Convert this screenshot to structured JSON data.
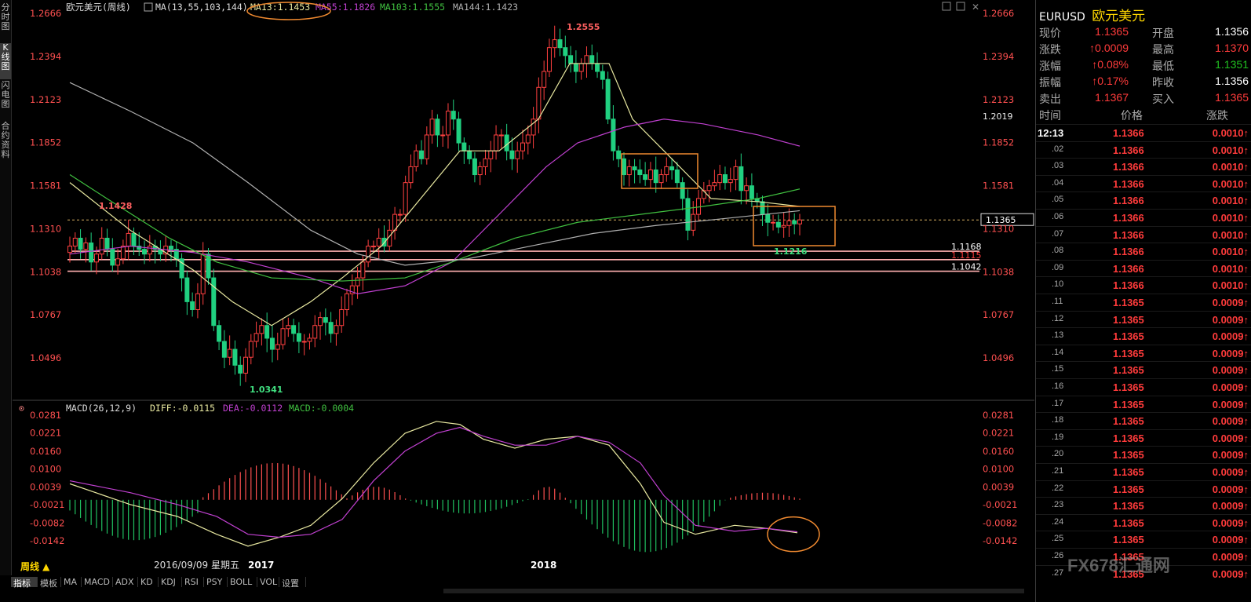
{
  "left_tabs": [
    {
      "label": "分时图",
      "active": false
    },
    {
      "label": "K线图",
      "active": true
    },
    {
      "label": "闪电图",
      "active": false
    },
    {
      "label": "合约资料",
      "active": false
    }
  ],
  "chart": {
    "title": "欧元美元(周线)",
    "ma_label": "MA(13,55,103,144)",
    "ma13": "MA13:1.1453",
    "ma55": "MA55:1.1826",
    "ma103": "MA103:1.1555",
    "ma144": "MA144:1.1423",
    "y_ticks": [
      "1.2666",
      "1.2394",
      "1.2123",
      "1.1852",
      "1.1581",
      "1.1310",
      "1.1038",
      "1.0767",
      "1.0496"
    ],
    "high_label": "1.2555",
    "low_label": "1.0341",
    "left_high_label": "1.1428",
    "recent_low_label": "1.1216",
    "marker_1": "1.2019",
    "current_price": "1.1365",
    "level_1": "1.1168",
    "level_2": "1.1115",
    "level_3": "1.1042",
    "date_label": "2016/09/09  星期五",
    "x_labels": [
      "2017",
      "2018"
    ],
    "colors": {
      "ma13": "#e8e8a0",
      "ma55": "#c040d0",
      "ma103": "#40c040",
      "ma144": "#b0b0b0",
      "up": "#ff4040",
      "down": "#20d080"
    }
  },
  "macd": {
    "label": "MACD(26,12,9)",
    "diff": "DIFF:-0.0115",
    "dea": "DEA:-0.0112",
    "macd": "MACD:-0.0004",
    "y_ticks": [
      "0.0281",
      "0.0221",
      "0.0160",
      "0.0100",
      "0.0039",
      "-0.0021",
      "-0.0082",
      "-0.0142"
    ]
  },
  "bottom_tabs": [
    "指标",
    "模板",
    "MA",
    "MACD",
    "ADX",
    "KD",
    "KDJ",
    "RSI",
    "PSY",
    "BOLL",
    "VOL",
    "设置"
  ],
  "period_label": "周线 ▲",
  "quote": {
    "symbol": "EURUSD",
    "name": "欧元美元",
    "rows": [
      {
        "l1": "现价",
        "v1": "1.1365",
        "l2": "开盘",
        "v2": "1.1356"
      },
      {
        "l1": "涨跌",
        "v1": "0.0009",
        "l2": "最高",
        "v2": "1.1370"
      },
      {
        "l1": "涨幅",
        "v1": "0.08%",
        "l2": "最低",
        "v2": "1.1351"
      },
      {
        "l1": "振幅",
        "v1": "0.17%",
        "l2": "昨收",
        "v2": "1.1356"
      },
      {
        "l1": "卖出",
        "v1": "1.1367",
        "l2": "买入",
        "v2": "1.1365"
      }
    ],
    "tick_header": {
      "time": "时间",
      "price": "价格",
      "change": "涨跌"
    },
    "ticks": [
      {
        "t": "12:13",
        "p": "1.1366",
        "c": "0.0010"
      },
      {
        "t": ".02",
        "p": "1.1366",
        "c": "0.0010"
      },
      {
        "t": ".03",
        "p": "1.1366",
        "c": "0.0010"
      },
      {
        "t": ".04",
        "p": "1.1366",
        "c": "0.0010"
      },
      {
        "t": ".05",
        "p": "1.1366",
        "c": "0.0010"
      },
      {
        "t": ".06",
        "p": "1.1366",
        "c": "0.0010"
      },
      {
        "t": ".07",
        "p": "1.1366",
        "c": "0.0010"
      },
      {
        "t": ".08",
        "p": "1.1366",
        "c": "0.0010"
      },
      {
        "t": ".09",
        "p": "1.1366",
        "c": "0.0010"
      },
      {
        "t": ".10",
        "p": "1.1366",
        "c": "0.0010"
      },
      {
        "t": ".11",
        "p": "1.1365",
        "c": "0.0009"
      },
      {
        "t": ".12",
        "p": "1.1365",
        "c": "0.0009"
      },
      {
        "t": ".13",
        "p": "1.1365",
        "c": "0.0009"
      },
      {
        "t": ".14",
        "p": "1.1365",
        "c": "0.0009"
      },
      {
        "t": ".15",
        "p": "1.1365",
        "c": "0.0009"
      },
      {
        "t": ".16",
        "p": "1.1365",
        "c": "0.0009"
      },
      {
        "t": ".17",
        "p": "1.1365",
        "c": "0.0009"
      },
      {
        "t": ".18",
        "p": "1.1365",
        "c": "0.0009"
      },
      {
        "t": ".19",
        "p": "1.1365",
        "c": "0.0009"
      },
      {
        "t": ".20",
        "p": "1.1365",
        "c": "0.0009"
      },
      {
        "t": ".21",
        "p": "1.1365",
        "c": "0.0009"
      },
      {
        "t": ".22",
        "p": "1.1365",
        "c": "0.0009"
      },
      {
        "t": ".23",
        "p": "1.1365",
        "c": "0.0009"
      },
      {
        "t": ".24",
        "p": "1.1365",
        "c": "0.0009"
      },
      {
        "t": ".25",
        "p": "1.1365",
        "c": "0.0009"
      },
      {
        "t": ".26",
        "p": "1.1365",
        "c": "0.0009"
      },
      {
        "t": ".27",
        "p": "1.1365",
        "c": "0.0009"
      }
    ],
    "watermark": "FX678汇通网"
  }
}
